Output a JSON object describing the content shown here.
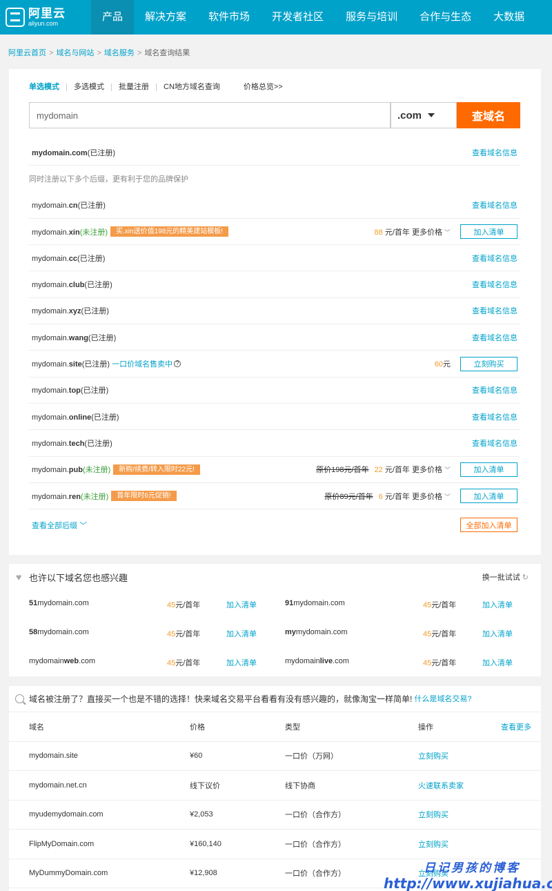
{
  "logo": {
    "cn": "阿里云",
    "en": "aliyun.com"
  },
  "nav": [
    "产品",
    "解决方案",
    "软件市场",
    "开发者社区",
    "服务与培训",
    "合作与生态",
    "大数据"
  ],
  "breadcrumb": [
    "阿里云首页",
    "域名与网站",
    "域名服务",
    "域名查询结果"
  ],
  "modes": [
    "单选模式",
    "多选模式",
    "批量注册",
    "CN地方域名查询"
  ],
  "price_overview": "价格总览>>",
  "search": {
    "value": "mydomain",
    "suffix": ".com",
    "button": "查域名"
  },
  "labels": {
    "view_info": "查看域名信息",
    "add_cart": "加入清单",
    "buy_now": "立刻购买",
    "more_price": "更多价格",
    "per_year": "元/首年",
    "yuan": "元",
    "orig_prefix": "原价",
    "view_all": "查看全部后缀",
    "add_all": "全部加入清单"
  },
  "primary": {
    "name": "mydomain.com",
    "status": "(已注册)"
  },
  "note": "同时注册以下多个后缀，更有利于您的品牌保护",
  "rows": [
    {
      "base": "mydomain.",
      "tld": "cn",
      "status": "(已注册)"
    },
    {
      "base": "mydomain.",
      "tld": "xin",
      "status": "(未注册)",
      "promo": "买.xin送价值198元的精美建站模板!",
      "price": "88"
    },
    {
      "base": "mydomain.",
      "tld": "cc",
      "status": "(已注册)"
    },
    {
      "base": "mydomain.",
      "tld": "club",
      "status": "(已注册)"
    },
    {
      "base": "mydomain.",
      "tld": "xyz",
      "status": "(已注册)"
    },
    {
      "base": "mydomain.",
      "tld": "wang",
      "status": "(已注册)"
    },
    {
      "base": "mydomain.",
      "tld": "site",
      "status": "(已注册)",
      "sale": "一口价域名售卖中",
      "price": "60"
    },
    {
      "base": "mydomain.",
      "tld": "top",
      "status": "(已注册)"
    },
    {
      "base": "mydomain.",
      "tld": "online",
      "status": "(已注册)"
    },
    {
      "base": "mydomain.",
      "tld": "tech",
      "status": "(已注册)"
    },
    {
      "base": "mydomain.",
      "tld": "pub",
      "status": "(未注册)",
      "promo": "新购/续费/转入限时22元!",
      "old": "198元/首年",
      "price": "22"
    },
    {
      "base": "mydomain.",
      "tld": "ren",
      "status": "(未注册)",
      "promo": "首年限时6元促销!",
      "old": "89元/首年",
      "price": "6"
    }
  ],
  "interest": {
    "title": "也许以下域名您也感兴趣",
    "refresh": "换一批试试",
    "items": [
      {
        "bold": "51",
        "rest": "mydomain.com",
        "price": "45",
        "unit": "元/首年",
        "add": "加入清单"
      },
      {
        "bold": "91",
        "rest": "mydomain.com",
        "price": "45",
        "unit": "元/首年",
        "add": "加入清单"
      },
      {
        "bold": "58",
        "rest": "mydomain.com",
        "price": "45",
        "unit": "元/首年",
        "add": "加入清单"
      },
      {
        "bold": "my",
        "rest": "mydomain.com",
        "price": "45",
        "unit": "元/首年",
        "add": "加入清单"
      },
      {
        "bold": "",
        "rest": "mydomain",
        "bold2": "web",
        "tail": ".com",
        "price": "45",
        "unit": "元/首年",
        "add": "加入清单"
      },
      {
        "bold": "",
        "rest": "mydomain",
        "bold2": "live",
        "tail": ".com",
        "price": "45",
        "unit": "元/首年",
        "add": "加入清单"
      }
    ]
  },
  "trade": {
    "title": "域名被注册了？直接买一个也是不错的选择！快来域名交易平台看看有没有感兴趣的，就像淘宝一样简单!",
    "what": "什么是域名交易?",
    "headers": [
      "域名",
      "价格",
      "类型",
      "操作"
    ],
    "more": "查看更多",
    "rows": [
      {
        "name": "mydomain.site",
        "price": "¥60",
        "type": "一口价（万网）",
        "op": "立刻购买"
      },
      {
        "name": "mydomain.net.cn",
        "price": "线下议价",
        "type": "线下协商",
        "op": "火速联系卖家"
      },
      {
        "name": "myudemydomain.com",
        "price": "¥2,053",
        "type": "一口价（合作方）",
        "op": "立刻购买"
      },
      {
        "name": "FlipMyDomain.com",
        "price": "¥160,140",
        "type": "一口价（合作方）",
        "op": "立刻购买"
      },
      {
        "name": "MyDummyDomain.com",
        "price": "¥12,908",
        "type": "一口价（合作方）",
        "op": "立刻购买"
      }
    ]
  },
  "watermark": {
    "line1": "日记男孩的博客",
    "line2": "http://www.xujiahua.com"
  }
}
